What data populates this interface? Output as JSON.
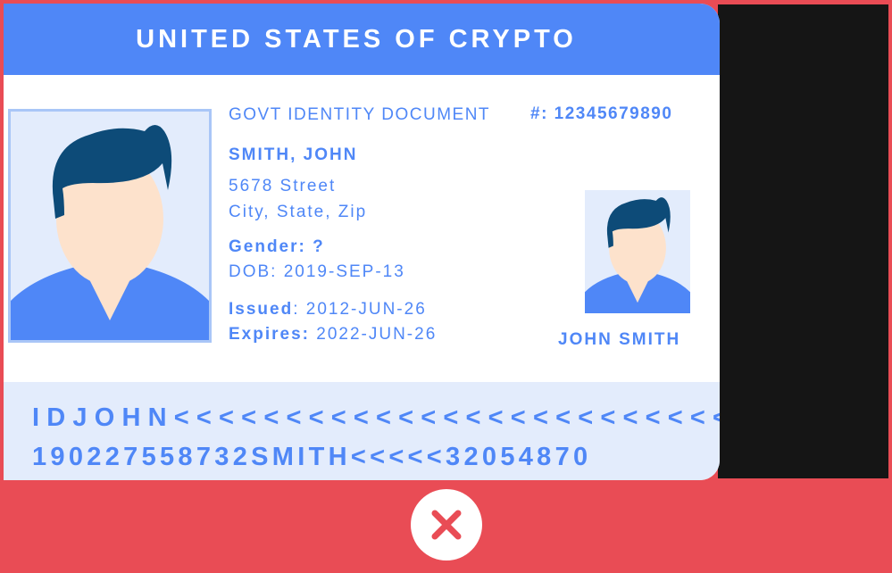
{
  "card": {
    "title": "UNITED STATES OF CRYPTO",
    "doc_type": "GOVT IDENTITY DOCUMENT",
    "doc_number": "#: 12345679890",
    "name": "SMITH, JOHN",
    "address_line1": "5678 Street",
    "address_line2": "City, State, Zip",
    "gender": "Gender: ?",
    "dob": "DOB: 2019-SEP-13",
    "issued_label": "Issued",
    "issued_value": ": 2012-JUN-26",
    "expires_label": "Expires:",
    "expires_value": " 2022-JUN-26",
    "photo_caption": "JOHN SMITH"
  },
  "mrz": {
    "line1": "IDJOHN<<<<<<<<<<<<<<<<<<<<<<<<<",
    "line2": "190227558732SMITH<<<<<32054870"
  },
  "icons": {
    "portrait": "person-portrait-icon",
    "reject": "close-x-icon"
  },
  "colors": {
    "brand_blue": "#4f87f7",
    "light_blue": "#e3ecfc",
    "reject_red": "#e94c55",
    "hair": "#0d4b78",
    "skin": "#fde2cc",
    "dark_panel": "#151515"
  }
}
